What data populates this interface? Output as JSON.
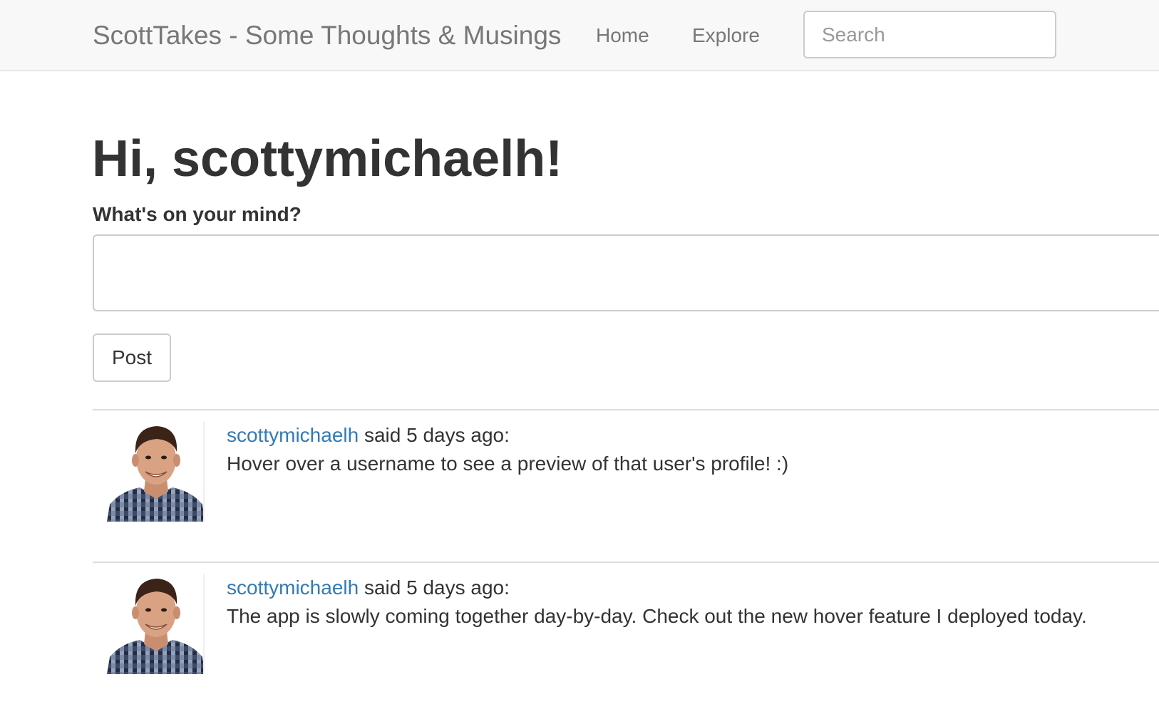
{
  "navbar": {
    "brand": "ScottTakes - Some Thoughts & Musings",
    "links": [
      {
        "label": "Home"
      },
      {
        "label": "Explore"
      }
    ],
    "search": {
      "placeholder": "Search",
      "value": ""
    }
  },
  "main": {
    "greeting": "Hi, scottymichaelh!",
    "form": {
      "label": "What's on your mind?",
      "value": "",
      "submit_label": "Post"
    },
    "posts": [
      {
        "author": "scottymichaelh",
        "meta_suffix": " said 5 days ago:",
        "body": "Hover over a username to see a preview of that user's profile! :)"
      },
      {
        "author": "scottymichaelh",
        "meta_suffix": " said 5 days ago:",
        "body": "The app is slowly coming together day-by-day. Check out the new hover feature I deployed today."
      }
    ]
  },
  "colors": {
    "navbar_bg": "#f8f8f8",
    "link": "#337ab7",
    "text": "#333333",
    "muted": "#777777"
  }
}
